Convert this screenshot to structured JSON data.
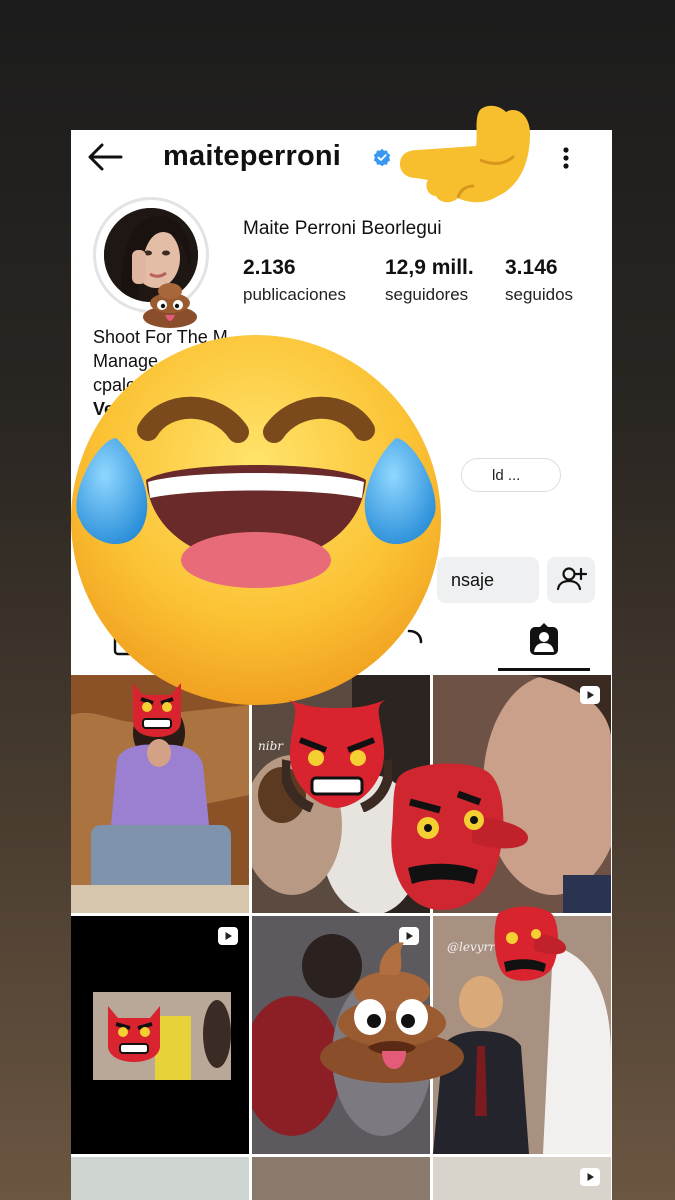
{
  "profile": {
    "username": "maiteperroni",
    "full_name": "Maite Perroni Beorlegui",
    "stats": [
      {
        "value": "2.136",
        "label": "publicaciones"
      },
      {
        "value": "12,9 mill.",
        "label": "seguidores"
      },
      {
        "value": "3.146",
        "label": "seguidos"
      }
    ],
    "bio_lines": [
      "Shoot For The M",
      "Manage",
      "cpalo",
      "Ve"
    ],
    "link_pill": "ld ...",
    "message_button": "nsaje"
  },
  "grid_watermarks": {
    "tile2": "nibr",
    "tile6": "@levyrronibi"
  },
  "colors": {
    "verified": "#3897f0",
    "text": "#111111",
    "button_bg": "#eef0f2"
  },
  "icons": [
    "back-arrow-icon",
    "verified-badge-icon",
    "more-options-icon",
    "add-person-icon",
    "tagged-tab-icon",
    "play-icon"
  ],
  "stickers": [
    "pointing-hand-emoji",
    "poop-emoji",
    "laughing-crying-emoji",
    "tengu-mask-emoji"
  ]
}
